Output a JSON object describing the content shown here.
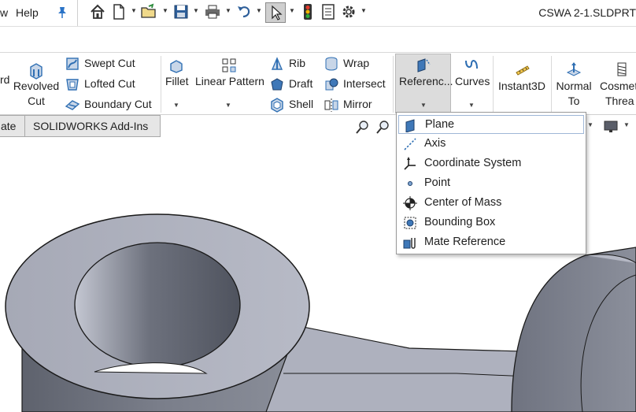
{
  "menubar": {
    "items": [
      "w",
      "Help"
    ],
    "document_title": "CSWA 2-1.SLDPRT"
  },
  "quick_access": {
    "icons": [
      "home-icon",
      "new-document-icon",
      "open-folder-icon",
      "save-icon",
      "print-icon",
      "undo-icon",
      "select-pointer-icon",
      "traffic-light-icon",
      "file-properties-icon",
      "options-gear-icon"
    ]
  },
  "ribbon": {
    "partial_left": "rd",
    "revolved_cut": [
      "Revolved",
      "Cut"
    ],
    "swept_cut": "Swept Cut",
    "lofted_cut": "Lofted Cut",
    "boundary_cut": "Boundary Cut",
    "fillet": "Fillet",
    "linear_pattern": "Linear Pattern",
    "rib": "Rib",
    "draft": "Draft",
    "shell": "Shell",
    "wrap": "Wrap",
    "intersect": "Intersect",
    "mirror": "Mirror",
    "reference": "Referenc...",
    "curves": "Curves",
    "instant3d": "Instant3D",
    "normal_to": [
      "Normal",
      "To"
    ],
    "cosmetic_thread": [
      "Cosmet",
      "Threa"
    ]
  },
  "tabs": {
    "partial": "ate",
    "addins": "SOLIDWORKS Add-Ins"
  },
  "dropdown": {
    "items": [
      {
        "label": "Plane",
        "icon": "plane-icon"
      },
      {
        "label": "Axis",
        "icon": "axis-icon"
      },
      {
        "label": "Coordinate System",
        "icon": "coordinate-system-icon"
      },
      {
        "label": "Point",
        "icon": "point-icon"
      },
      {
        "label": "Center of Mass",
        "icon": "center-of-mass-icon"
      },
      {
        "label": "Bounding Box",
        "icon": "bounding-box-icon"
      },
      {
        "label": "Mate Reference",
        "icon": "mate-reference-icon"
      }
    ],
    "selected_index": 0
  },
  "colors": {
    "model_face": "#8e929e",
    "model_light": "#c2c5d0",
    "model_dark": "#5a5e69",
    "tab_bg": "#e6e6e6",
    "active_button_bg": "#dcdcdc",
    "icon_blue": "#2f6fb3"
  }
}
